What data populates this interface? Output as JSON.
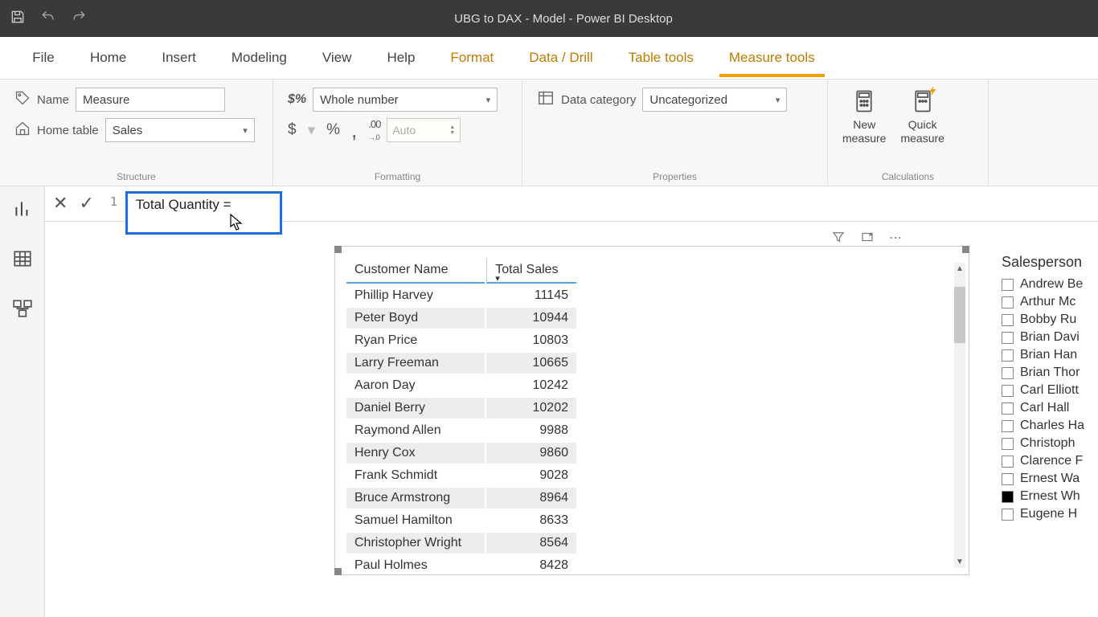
{
  "titlebar": {
    "title": "UBG to DAX - Model - Power BI Desktop"
  },
  "menubar": {
    "file": "File",
    "tabs": [
      "Home",
      "Insert",
      "Modeling",
      "View",
      "Help"
    ],
    "ctx_tabs": [
      "Format",
      "Data / Drill",
      "Table tools",
      "Measure tools"
    ],
    "active": "Measure tools"
  },
  "ribbon": {
    "structure": {
      "name_label": "Name",
      "name_value": "Measure",
      "home_table_label": "Home table",
      "home_table_value": "Sales",
      "caption": "Structure"
    },
    "formatting": {
      "format_value": "Whole number",
      "currency": "$",
      "percent": "%",
      "comma": ",",
      "decimals": ".00",
      "auto": "Auto",
      "caption": "Formatting"
    },
    "properties": {
      "category_label": "Data category",
      "category_value": "Uncategorized",
      "caption": "Properties"
    },
    "calculations": {
      "new_measure": "New\nmeasure",
      "quick_measure": "Quick\nmeasure",
      "caption": "Calculations"
    }
  },
  "formula": {
    "line": "1",
    "text": "Total Quantity ="
  },
  "table": {
    "headers": [
      "Customer Name",
      "Total Sales"
    ],
    "rows": [
      [
        "Phillip Harvey",
        "11145"
      ],
      [
        "Peter Boyd",
        "10944"
      ],
      [
        "Ryan Price",
        "10803"
      ],
      [
        "Larry Freeman",
        "10665"
      ],
      [
        "Aaron Day",
        "10242"
      ],
      [
        "Daniel Berry",
        "10202"
      ],
      [
        "Raymond Allen",
        "9988"
      ],
      [
        "Henry Cox",
        "9860"
      ],
      [
        "Frank Schmidt",
        "9028"
      ],
      [
        "Bruce Armstrong",
        "8964"
      ],
      [
        "Samuel Hamilton",
        "8633"
      ],
      [
        "Christopher Wright",
        "8564"
      ],
      [
        "Paul Holmes",
        "8428"
      ]
    ]
  },
  "slicer": {
    "title": "Salesperson",
    "items": [
      "Andrew Be",
      "Arthur Mc",
      "Bobby Ru",
      "Brian Davi",
      "Brian Han",
      "Brian Thor",
      "Carl Elliott",
      "Carl Hall",
      "Charles Ha",
      "Christoph",
      "Clarence F",
      "Ernest Wa",
      "Ernest Wh",
      "Eugene H"
    ],
    "selected_index": 12
  }
}
